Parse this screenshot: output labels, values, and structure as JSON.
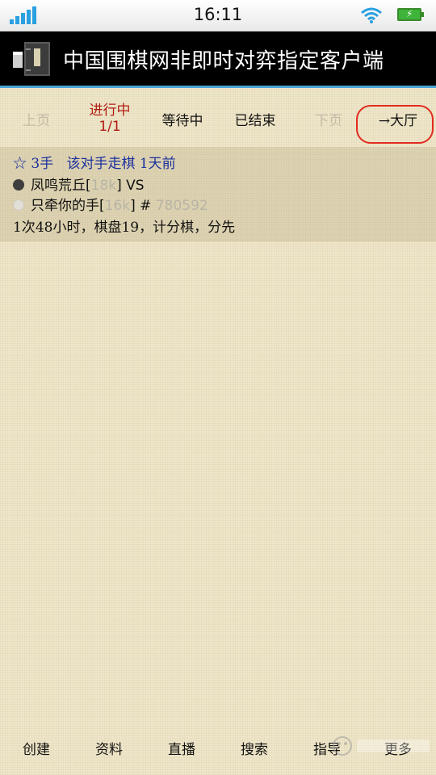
{
  "status_bar": {
    "time": "16:11"
  },
  "app": {
    "title": "中国围棋网非即时对弈指定客户端"
  },
  "nav": {
    "prev_page": "上页",
    "in_progress": "进行中",
    "in_progress_page": "1/1",
    "waiting": "等待中",
    "finished": "已结束",
    "next_page": "下页",
    "lobby": "→大厅"
  },
  "game": {
    "star": "☆",
    "moves": "3手",
    "status": "该对手走棋 1天前",
    "black_player": "凤鸣荒丘",
    "black_rank": "18k",
    "vs": "VS",
    "white_player": "只牵你的手",
    "white_rank": "16k",
    "game_id_prefix": "#",
    "game_id": "780592",
    "rules": "1次48小时，棋盘19，计分棋，分先"
  },
  "tabs": [
    {
      "label": "创建"
    },
    {
      "label": "资料"
    },
    {
      "label": "直播"
    },
    {
      "label": "搜索"
    },
    {
      "label": "指导"
    },
    {
      "label": "更多"
    }
  ],
  "colors": {
    "header_bg": "#000000",
    "accent_blue": "#1a30a0",
    "active_red": "#b01c10",
    "annotation_red": "#e22a1e",
    "paper_bg": "#efe6c9"
  }
}
